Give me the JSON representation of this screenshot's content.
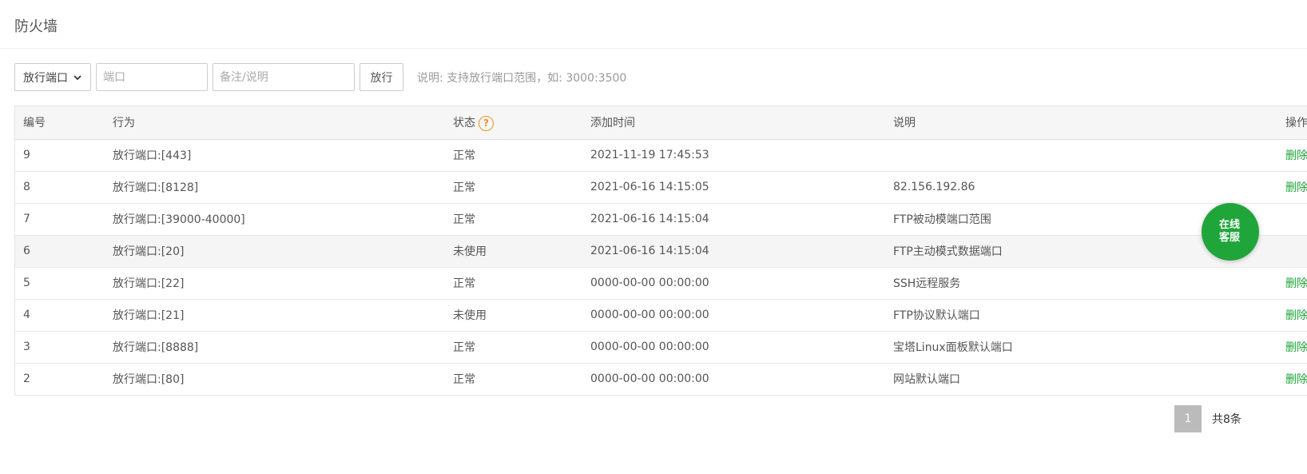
{
  "page": {
    "title": "防火墙"
  },
  "toolbar": {
    "select_value": "放行端口",
    "port_placeholder": "端口",
    "note_placeholder": "备注/说明",
    "allow_label": "放行",
    "hint": "说明: 支持放行端口范围，如: 3000:3500"
  },
  "table": {
    "headers": {
      "id": "编号",
      "action": "行为",
      "status": "状态",
      "added": "添加时间",
      "desc": "说明",
      "op": "操作"
    },
    "help_icon_text": "?",
    "rows": [
      {
        "id": "9",
        "action": "放行端口:[443]",
        "status": "正常",
        "added": "2021-11-19 17:45:53",
        "desc": "",
        "op": "删除"
      },
      {
        "id": "8",
        "action": "放行端口:[8128]",
        "status": "正常",
        "added": "2021-06-16 14:15:05",
        "desc": "82.156.192.86",
        "op": "删除"
      },
      {
        "id": "7",
        "action": "放行端口:[39000-40000]",
        "status": "正常",
        "added": "2021-06-16 14:15:04",
        "desc": "FTP被动模端口范围",
        "op": ""
      },
      {
        "id": "6",
        "action": "放行端口:[20]",
        "status": "未使用",
        "added": "2021-06-16 14:15:04",
        "desc": "FTP主动模式数据端口",
        "op": ""
      },
      {
        "id": "5",
        "action": "放行端口:[22]",
        "status": "正常",
        "added": "0000-00-00 00:00:00",
        "desc": "SSH远程服务",
        "op": "删除"
      },
      {
        "id": "4",
        "action": "放行端口:[21]",
        "status": "未使用",
        "added": "0000-00-00 00:00:00",
        "desc": "FTP协议默认端口",
        "op": "删除"
      },
      {
        "id": "3",
        "action": "放行端口:[8888]",
        "status": "正常",
        "added": "0000-00-00 00:00:00",
        "desc": "宝塔Linux面板默认端口",
        "op": "删除"
      },
      {
        "id": "2",
        "action": "放行端口:[80]",
        "status": "正常",
        "added": "0000-00-00 00:00:00",
        "desc": "网站默认端口",
        "op": "删除"
      }
    ]
  },
  "pagination": {
    "current": "1",
    "total": "共8条"
  },
  "chat": {
    "line1": "在线",
    "line2": "客服"
  },
  "colors": {
    "accent": "#20a53a",
    "help": "#f0901d",
    "header_bg": "#f6f6f6"
  }
}
